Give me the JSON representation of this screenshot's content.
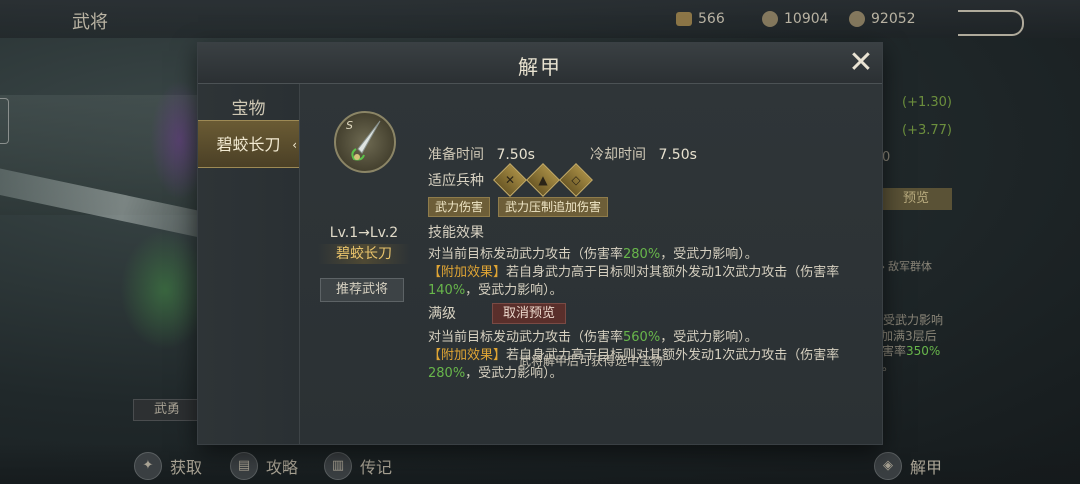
{
  "topbar": {
    "title": "武将",
    "res_a": "566",
    "res_b": "10904",
    "res_c": "92052"
  },
  "background": {
    "right_top_1": "(+1.30)",
    "right_top_2": "(+3.77)",
    "right_digit": "0",
    "right_preview": "预览",
    "right_tag": "◆ 敌军群体",
    "right_text_1": "受武力影响",
    "right_text_2": "加满3层后",
    "right_text_3a": "害率",
    "right_text_3b": "350%",
    "right_text_4": "。",
    "badge_wuyong": "武勇"
  },
  "bottombar": {
    "obtain": "获取",
    "guide": "攻略",
    "biography": "传记",
    "unequip": "解甲"
  },
  "modal": {
    "title": "解甲",
    "close_glyph": "✕",
    "sidebar": {
      "category": "宝物",
      "selected": "碧蛟长刀",
      "chevron": "‹"
    },
    "weapon": {
      "quality_letter": "S",
      "level": "Lv.1→Lv.2",
      "name": "碧蛟长刀",
      "recommend_button": "推荐武将"
    },
    "stats": {
      "prep_label": "准备时间",
      "prep_value": "7.50s",
      "cooldown_label": "冷却时间",
      "cooldown_value": "7.50s",
      "troops_label": "适应兵种",
      "troops_icons": [
        "✕",
        "▲",
        "◇"
      ]
    },
    "tags": [
      "武力伤害",
      "武力压制追加伤害"
    ],
    "effect": {
      "heading": "技能效果",
      "line1_pre": "对当前目标发动武力攻击（伤害率",
      "line1_rate": "280%",
      "line1_post": "，受武力影响）。",
      "extra_label": "【附加效果】",
      "extra_text": "若自身武力高于目标则对其额外发动1次武力攻击（伤害率",
      "extra_rate": "140%",
      "extra_post": "，受武力影响）。"
    },
    "maxlevel": {
      "heading": "满级",
      "cancel_button": "取消预览",
      "line1_pre": "对当前目标发动武力攻击（伤害率",
      "line1_rate": "560%",
      "line1_post": "，受武力影响）。",
      "extra_label": "【附加效果】",
      "extra_text": "若自身武力高于目标则对其额外发动1次武力攻击（伤害率",
      "extra_rate": "280%",
      "extra_post": "，受武力影响）。"
    },
    "footer": "武将解甲后可获得选中宝物"
  }
}
